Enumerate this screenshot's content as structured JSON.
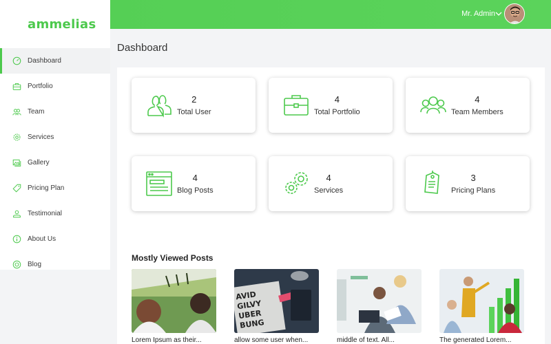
{
  "brand": {
    "logo": "ammelias",
    "accent": "#4cc94c"
  },
  "header": {
    "user_name": "Mr. Admin"
  },
  "sidebar": {
    "items": [
      {
        "label": "Dashboard",
        "icon": "dashboard-gauge-icon",
        "active": true
      },
      {
        "label": "Portfolio",
        "icon": "briefcase-icon"
      },
      {
        "label": "Team",
        "icon": "team-icon"
      },
      {
        "label": "Services",
        "icon": "gear-icon"
      },
      {
        "label": "Gallery",
        "icon": "gallery-icon"
      },
      {
        "label": "Pricing Plan",
        "icon": "price-tag-icon"
      },
      {
        "label": "Testimonial",
        "icon": "user-badge-icon"
      },
      {
        "label": "About Us",
        "icon": "info-icon"
      },
      {
        "label": "Blog",
        "icon": "blog-icon"
      }
    ]
  },
  "page": {
    "title": "Dashboard"
  },
  "stats": [
    {
      "value": "2",
      "label": "Total User",
      "icon": "users-icon"
    },
    {
      "value": "4",
      "label": "Total Portfolio",
      "icon": "briefcase-icon"
    },
    {
      "value": "4",
      "label": "Team Members",
      "icon": "team-icon"
    },
    {
      "value": "4",
      "label": "Blog Posts",
      "icon": "browser-window-icon"
    },
    {
      "value": "4",
      "label": "Services",
      "icon": "gears-icon"
    },
    {
      "value": "3",
      "label": "Pricing Plans",
      "icon": "price-tag-icon"
    }
  ],
  "posts_section": {
    "title": "Mostly Viewed Posts",
    "posts": [
      {
        "caption": "Lorem Ipsum as their..."
      },
      {
        "caption": "allow some user when..."
      },
      {
        "caption": "middle of text. All..."
      },
      {
        "caption": "The generated Lorem..."
      }
    ]
  }
}
